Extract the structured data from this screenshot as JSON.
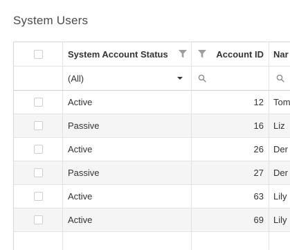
{
  "page": {
    "title": "System Users"
  },
  "grid": {
    "columns": [
      {
        "label": ""
      },
      {
        "label": "System Account Status"
      },
      {
        "label": "Account ID"
      },
      {
        "label": "Nar"
      }
    ],
    "filter_row": {
      "status_selected": "(All)"
    },
    "rows": [
      {
        "status": "Active",
        "account_id": "12",
        "name": "Tom"
      },
      {
        "status": "Passive",
        "account_id": "16",
        "name": "Liz"
      },
      {
        "status": "Active",
        "account_id": "26",
        "name": "Der"
      },
      {
        "status": "Passive",
        "account_id": "27",
        "name": "Der"
      },
      {
        "status": "Active",
        "account_id": "63",
        "name": "Lily"
      },
      {
        "status": "Active",
        "account_id": "69",
        "name": "Lily"
      }
    ]
  },
  "icons": {
    "filter": "filter-icon",
    "search": "search-icon",
    "dropdown": "chevron-down-icon"
  },
  "colors": {
    "text": "#333333",
    "title": "#4a4a4a",
    "border": "#e2e2e2",
    "alt_row": "#f5f5f5",
    "icon": "#9e9e9e"
  }
}
